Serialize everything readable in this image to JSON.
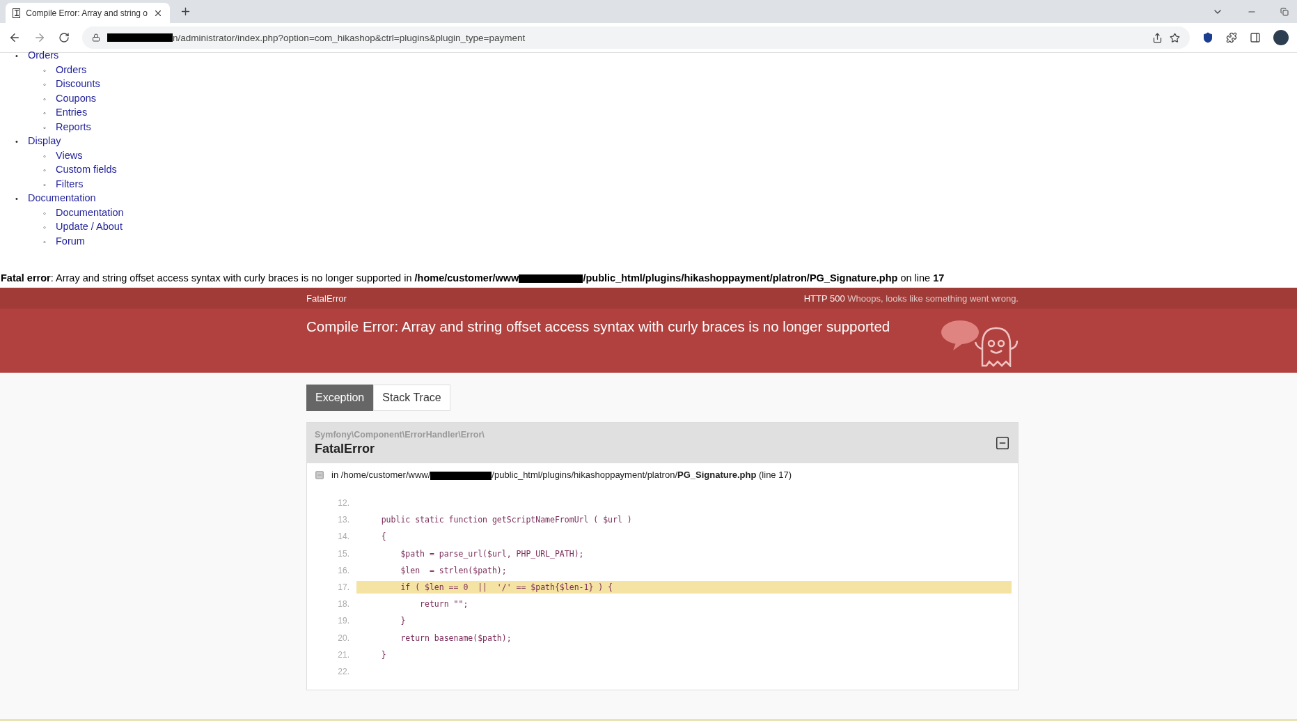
{
  "browser": {
    "tab_title": "Compile Error: Array and string o",
    "url": "n/administrator/index.php?option=com_hikashop&ctrl=plugins&plugin_type=payment"
  },
  "menu": [
    {
      "marker": "•",
      "label": "Orders",
      "children": [
        {
          "marker": "◦",
          "label": "Orders"
        },
        {
          "marker": "◦",
          "label": "Discounts"
        },
        {
          "marker": "◦",
          "label": "Coupons"
        },
        {
          "marker": "◦",
          "label": "Entries"
        },
        {
          "marker": "◦",
          "label": "Reports"
        }
      ]
    },
    {
      "marker": "•",
      "label": "Display",
      "children": [
        {
          "marker": "◦",
          "label": "Views"
        },
        {
          "marker": "◦",
          "label": "Custom fields"
        },
        {
          "marker": "◦",
          "label": "Filters"
        }
      ]
    },
    {
      "marker": "•",
      "label": "Documentation",
      "children": [
        {
          "marker": "◦",
          "label": "Documentation"
        },
        {
          "marker": "◦",
          "label": "Update / About"
        },
        {
          "marker": "◦",
          "label": "Forum"
        }
      ]
    }
  ],
  "fatal_error": {
    "label": "Fatal error",
    "message": ": Array and string offset access syntax with curly braces is no longer supported in ",
    "path_start": "/home/customer/www",
    "path_end": "/public_html/plugins/hikashoppayment/platron/PG_Signature.php",
    "line_label": " on line ",
    "line": "17"
  },
  "error_header": {
    "class": "FatalError",
    "status": "HTTP 500",
    "status_text": "Whoops, looks like something went wrong.",
    "title": "Compile Error: Array and string offset access syntax with curly braces is no longer supported"
  },
  "tabs": [
    {
      "label": "Exception",
      "selected": true
    },
    {
      "label": "Stack Trace",
      "selected": false
    }
  ],
  "exception": {
    "namespace": "Symfony\\Component\\ErrorHandler\\Error\\",
    "class": "FatalError",
    "file_prefix": "in /home/customer/www/",
    "file_middle": "/public_html/plugins/hikashoppayment/platron/",
    "file_name": "PG_Signature.php",
    "file_line": "(line 17)",
    "code": [
      {
        "number": "12.",
        "highlighted": false
      },
      {
        "number": "13.",
        "text": "    public static function getScriptNameFromUrl ( $url )",
        "highlighted": false
      },
      {
        "number": "14.",
        "text": "    {",
        "highlighted": false
      },
      {
        "number": "15.",
        "text": "        $path = parse_url($url, PHP_URL_PATH);",
        "highlighted": false
      },
      {
        "number": "16.",
        "text": "        $len  = strlen($path);",
        "highlighted": false
      },
      {
        "number": "17.",
        "text": "        if ( $len == 0  ||  '/' == $path{$len-1} ) {",
        "highlighted": true
      },
      {
        "number": "18.",
        "text": "            return \"\";",
        "highlighted": false
      },
      {
        "number": "19.",
        "text": "        }",
        "highlighted": false
      },
      {
        "number": "20.",
        "text": "        return basename($path);",
        "highlighted": false
      },
      {
        "number": "21.",
        "text": "    }",
        "highlighted": false
      },
      {
        "number": "22.",
        "highlighted": false
      }
    ]
  }
}
